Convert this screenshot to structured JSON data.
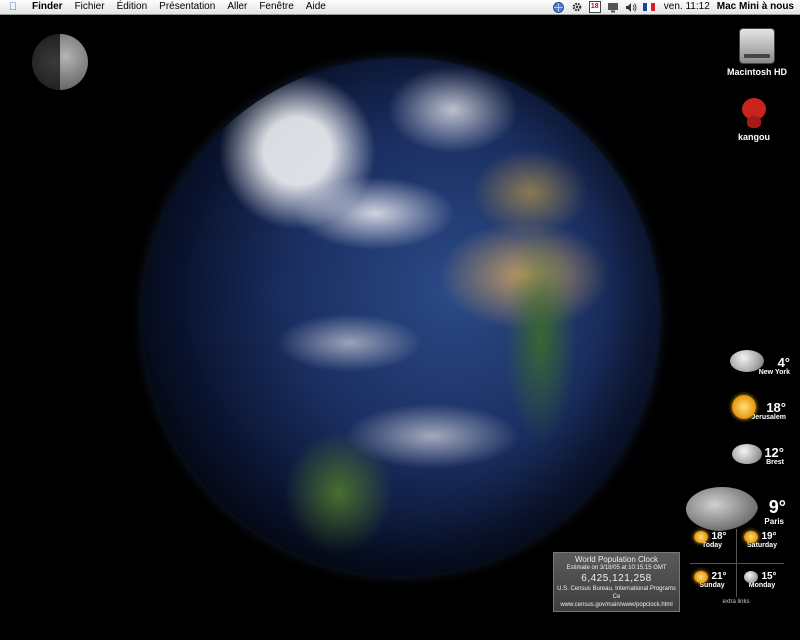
{
  "menubar": {
    "menus": [
      "Finder",
      "Fichier",
      "Édition",
      "Présentation",
      "Aller",
      "Fenêtre",
      "Aide"
    ],
    "calendar_day": "18",
    "clock": "ven. 11:12",
    "user": "Mac Mini à nous"
  },
  "desktop": {
    "icons": [
      {
        "label": "Macintosh HD"
      },
      {
        "label": "kangou"
      }
    ]
  },
  "weather": {
    "cities": [
      {
        "temp": "4°",
        "city": "New York"
      },
      {
        "temp": "18°",
        "city": "Jerusalem"
      },
      {
        "temp": "12°",
        "city": "Brest"
      }
    ],
    "paris": {
      "temp": "9°",
      "city": "Paris",
      "forecast": [
        {
          "day": "Today",
          "temp": "18°"
        },
        {
          "day": "Saturday",
          "temp": "19°"
        },
        {
          "day": "Sunday",
          "temp": "21°"
        },
        {
          "day": "Monday",
          "temp": "15°"
        }
      ],
      "extra_links": "extra links"
    }
  },
  "population_clock": {
    "title": "World Population Clock",
    "estimate": "Estimate on 3/18/05 at 10:15:15 GMT",
    "value": "6,425,121,258",
    "source": "U.S. Census Bureau, International Programs Ce",
    "url": "www.census.gov/main/www/popclock.html"
  }
}
